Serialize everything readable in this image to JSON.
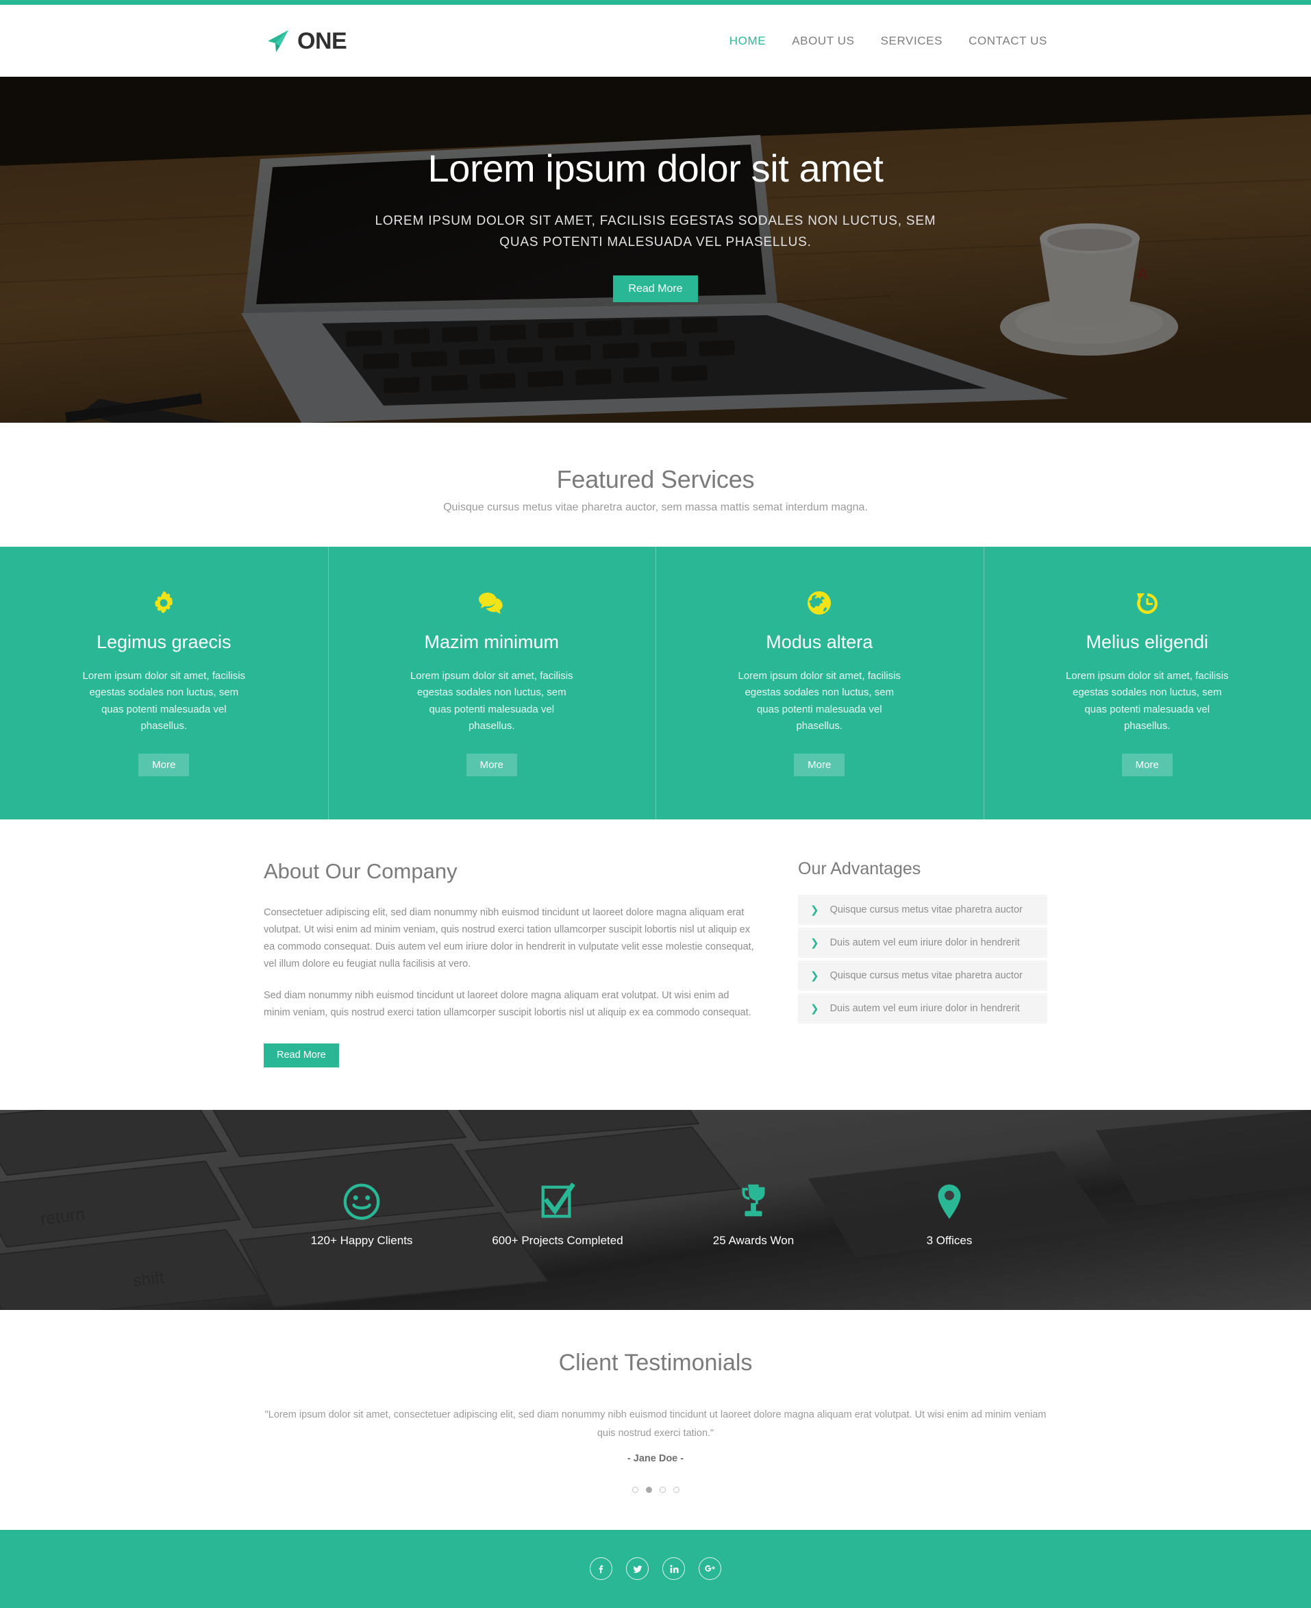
{
  "brand": {
    "name": "ONE",
    "logo_icon": "paper-plane-icon",
    "accent_color": "#2ab795"
  },
  "nav": {
    "items": [
      {
        "label": "HOME",
        "active": true
      },
      {
        "label": "ABOUT US",
        "active": false
      },
      {
        "label": "SERVICES",
        "active": false
      },
      {
        "label": "CONTACT US",
        "active": false
      }
    ]
  },
  "hero": {
    "title": "Lorem ipsum dolor sit amet",
    "subtitle": "LOREM IPSUM DOLOR SIT AMET, FACILISIS EGESTAS SODALES NON LUCTUS, SEM QUAS POTENTI MALESUADA VEL PHASELLUS.",
    "cta_label": "Read More"
  },
  "featured": {
    "title": "Featured Services",
    "subtitle": "Quisque cursus metus vitae pharetra auctor, sem massa mattis semat interdum magna.",
    "cards": [
      {
        "icon": "gear-icon",
        "title": "Legimus graecis",
        "text": "Lorem ipsum dolor sit amet, facilisis egestas sodales non luctus, sem quas potenti malesuada vel phasellus.",
        "button": "More"
      },
      {
        "icon": "chat-bubbles-icon",
        "title": "Mazim minimum",
        "text": "Lorem ipsum dolor sit amet, facilisis egestas sodales non luctus, sem quas potenti malesuada vel phasellus.",
        "button": "More"
      },
      {
        "icon": "globe-icon",
        "title": "Modus altera",
        "text": "Lorem ipsum dolor sit amet, facilisis egestas sodales non luctus, sem quas potenti malesuada vel phasellus.",
        "button": "More"
      },
      {
        "icon": "history-rotate-icon",
        "title": "Melius eligendi",
        "text": "Lorem ipsum dolor sit amet, facilisis egestas sodales non luctus, sem quas potenti malesuada vel phasellus.",
        "button": "More"
      }
    ]
  },
  "about": {
    "title": "About Our Company",
    "paragraph1": "Consectetuer adipiscing elit, sed diam nonummy nibh euismod tincidunt ut laoreet dolore magna aliquam erat volutpat. Ut wisi enim ad minim veniam, quis nostrud exerci tation ullamcorper suscipit lobortis nisl ut aliquip ex ea commodo consequat. Duis autem vel eum iriure dolor in hendrerit in vulputate velit esse molestie consequat, vel illum dolore eu feugiat nulla facilisis at vero.",
    "paragraph2": "Sed diam nonummy nibh euismod tincidunt ut laoreet dolore magna aliquam erat volutpat. Ut wisi enim ad minim veniam, quis nostrud exerci tation ullamcorper suscipit lobortis nisl ut aliquip ex ea commodo consequat.",
    "cta_label": "Read More"
  },
  "advantages": {
    "title": "Our Advantages",
    "items": [
      {
        "label": "Quisque cursus metus vitae pharetra auctor",
        "icon": "chevron-right-icon"
      },
      {
        "label": "Duis autem vel eum iriure dolor in hendrerit",
        "icon": "chevron-right-icon"
      },
      {
        "label": "Quisque cursus metus vitae pharetra auctor",
        "icon": "chevron-right-icon"
      },
      {
        "label": "Duis autem vel eum iriure dolor in hendrerit",
        "icon": "chevron-right-icon"
      }
    ]
  },
  "stats": {
    "items": [
      {
        "icon": "smiley-face-icon",
        "label": "120+ Happy Clients"
      },
      {
        "icon": "check-square-icon",
        "label": "600+ Projects Completed"
      },
      {
        "icon": "trophy-icon",
        "label": "25 Awards Won"
      },
      {
        "icon": "map-pin-icon",
        "label": "3 Offices"
      }
    ]
  },
  "testimonials": {
    "title": "Client Testimonials",
    "quote": "\"Lorem ipsum dolor sit amet, consectetuer adipiscing elit, sed diam nonummy nibh euismod tincidunt ut laoreet dolore magna aliquam erat volutpat. Ut wisi enim ad minim veniam quis nostrud exerci tation.\"",
    "author": "- Jane Doe -",
    "dots": [
      {
        "active": false
      },
      {
        "active": true
      },
      {
        "active": false
      },
      {
        "active": false
      }
    ]
  },
  "footer": {
    "social": [
      {
        "icon": "facebook-icon",
        "glyph": "f"
      },
      {
        "icon": "twitter-icon",
        "glyph": "t"
      },
      {
        "icon": "linkedin-icon",
        "glyph": "in"
      },
      {
        "icon": "google-plus-icon",
        "glyph": "g+"
      }
    ]
  }
}
